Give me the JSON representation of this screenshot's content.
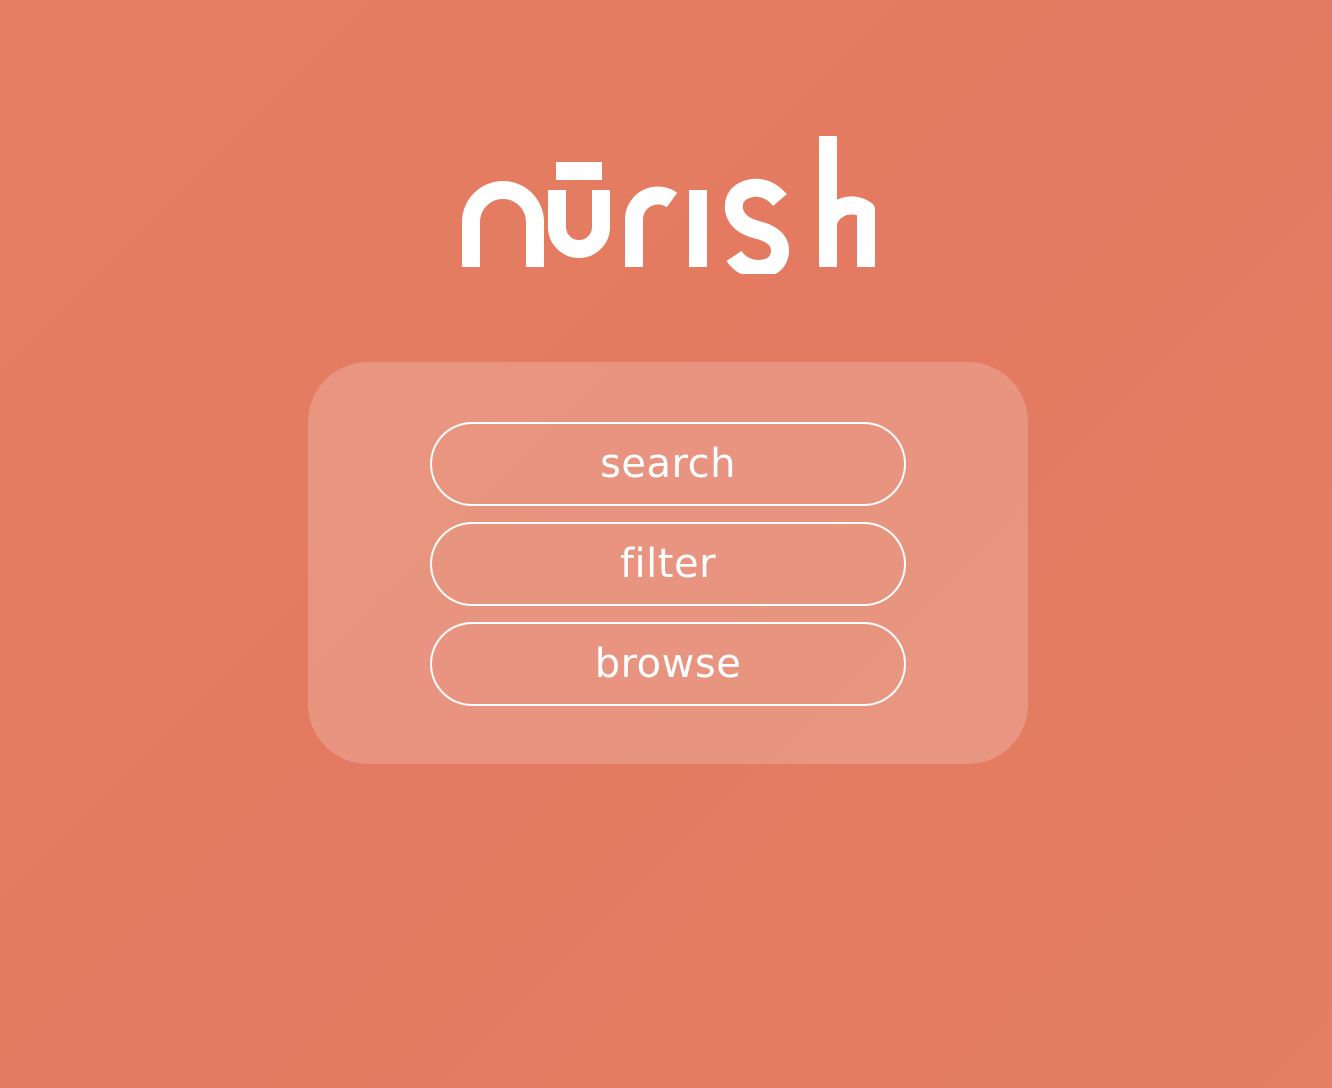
{
  "brand": {
    "name": "nūrish",
    "logo_color": "#ffffff"
  },
  "background": {
    "color": "#e47d62"
  },
  "menu": {
    "buttons": [
      {
        "label": "search"
      },
      {
        "label": "filter"
      },
      {
        "label": "browse"
      }
    ]
  }
}
